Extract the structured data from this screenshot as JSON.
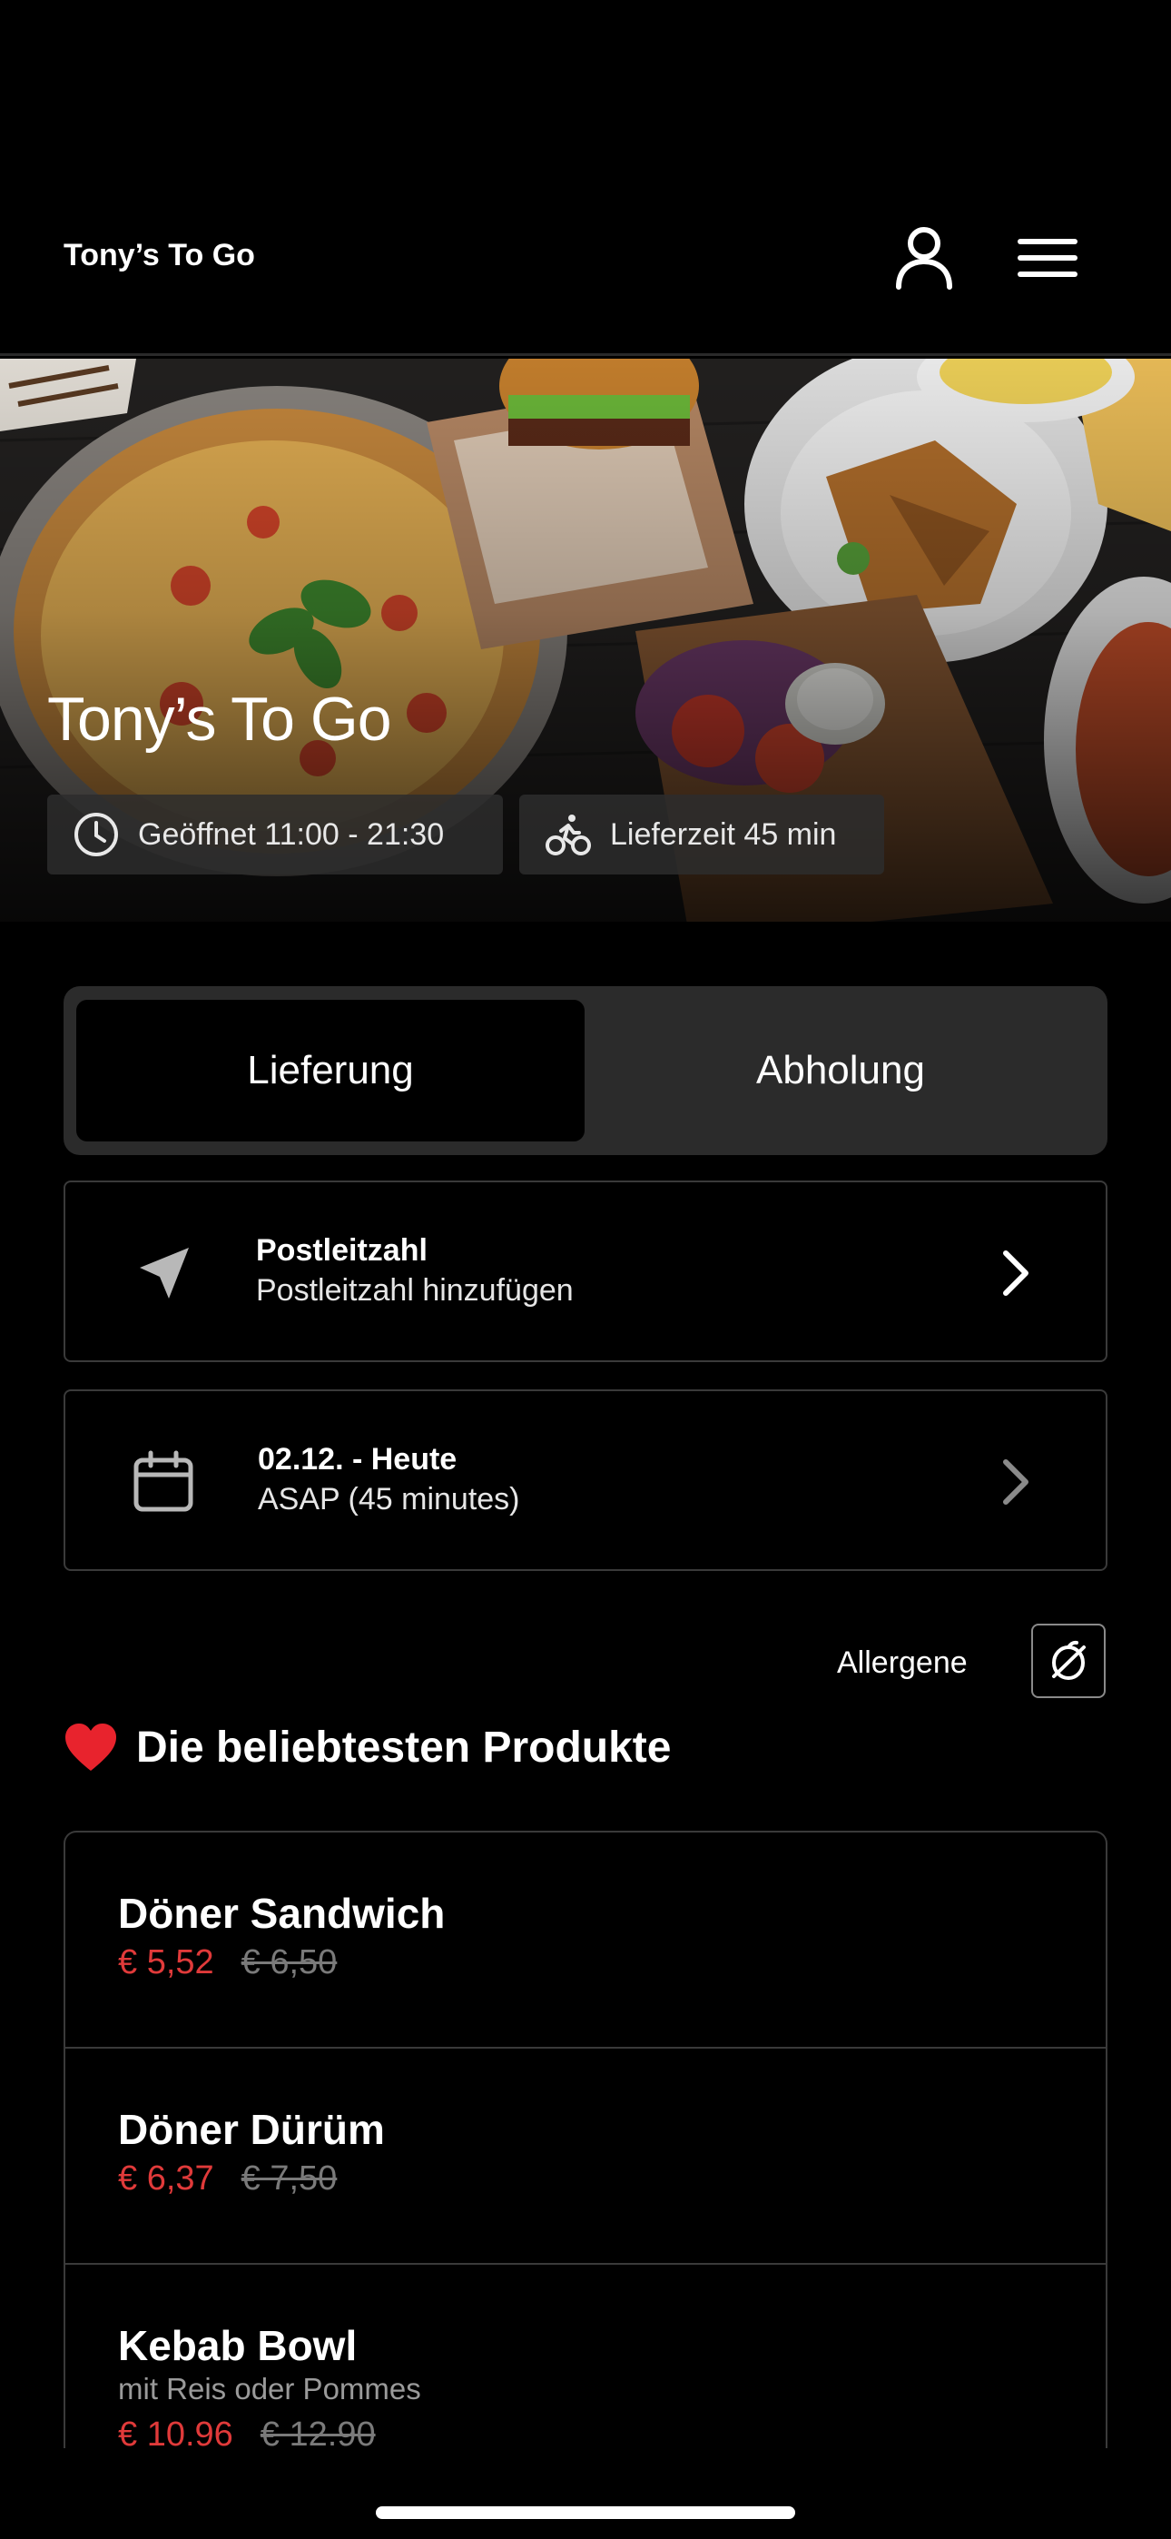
{
  "header": {
    "brand": "Tony’s To Go",
    "icons": {
      "account": "user-icon",
      "menu": "hamburger-menu-icon"
    }
  },
  "hero": {
    "title": "Tony’s To Go",
    "opening_hours": "Geöffnet 11:00 - 21:30",
    "delivery_time": "Lieferzeit 45 min",
    "icons": {
      "hours": "clock-icon",
      "delivery": "bicycle-icon"
    }
  },
  "order_mode": {
    "options": [
      "Lieferung",
      "Abholung"
    ],
    "selected": "Lieferung"
  },
  "postal_code": {
    "title": "Postleitzahl",
    "subtitle": "Postleitzahl hinzufügen",
    "icon": "location-arrow-icon"
  },
  "schedule": {
    "title": "02.12. - Heute",
    "subtitle": "ASAP (45 minutes)",
    "icon": "calendar-icon"
  },
  "allergens": {
    "label": "Allergene",
    "icon": "allergen-filter-icon"
  },
  "popular": {
    "title": "Die beliebtesten Produkte",
    "icon": "heart-icon",
    "products": [
      {
        "name": "Döner Sandwich",
        "description": "",
        "price": "€ 5,52",
        "old_price": "€ 6,50"
      },
      {
        "name": "Döner Dürüm",
        "description": "",
        "price": "€ 6,37",
        "old_price": "€ 7,50"
      },
      {
        "name": "Kebab Bowl",
        "description": "mit Reis oder Pommes",
        "price": "€ 10.96",
        "old_price": "€ 12.90"
      }
    ]
  },
  "colors": {
    "background": "#000000",
    "accent_price": "#e03a3a",
    "old_price": "#7a7a7a",
    "segment_bg": "#2b2b2b",
    "border": "#3a3a3a"
  }
}
